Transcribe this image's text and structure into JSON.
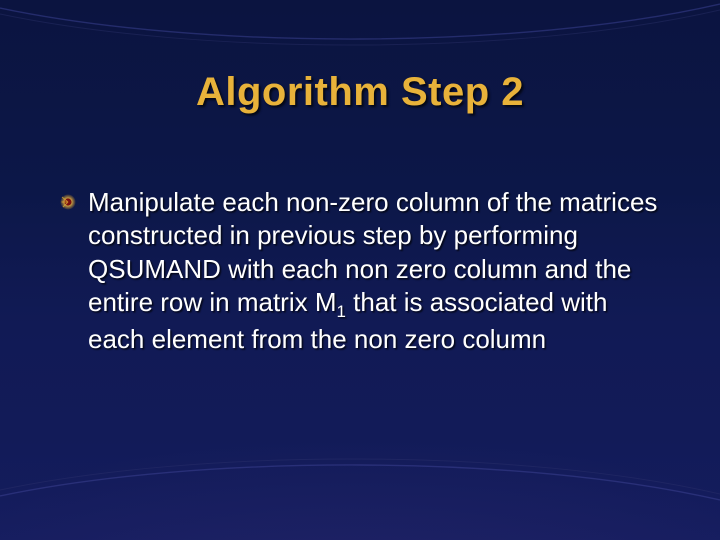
{
  "title": "Algorithm Step 2",
  "bullet": {
    "icon": "comet-bullet-icon",
    "text_pre": "Manipulate each non-zero column of the matrices constructed in previous step by performing QSUMAND  with each non zero column and the entire row in matrix M",
    "subscript": "1",
    "text_post": " that is associated with each element from the non zero column"
  },
  "colors": {
    "title": "#e8b23a",
    "body": "#ffffff",
    "bullet_glow": "#f5c24a",
    "bullet_core": "#7a0f10"
  }
}
